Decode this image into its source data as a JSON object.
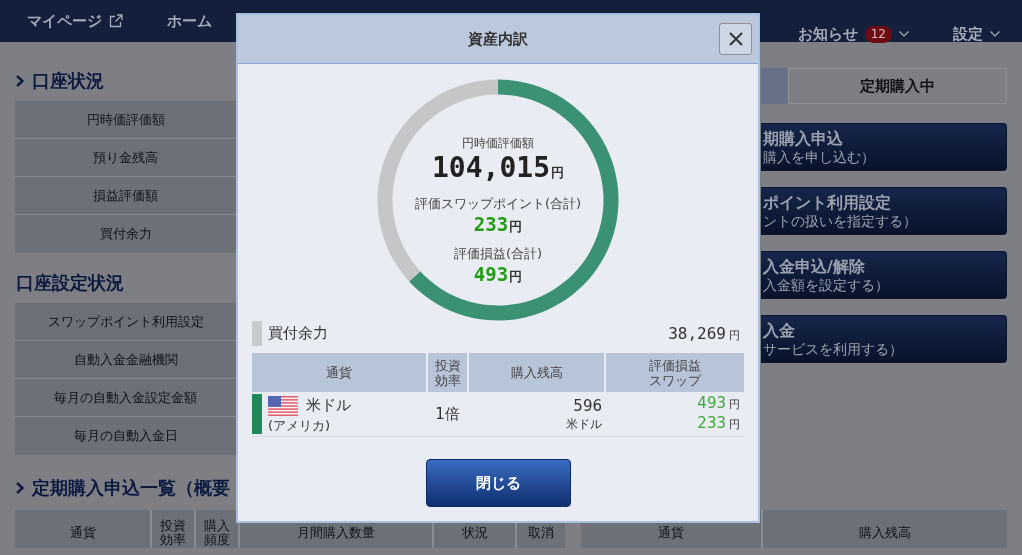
{
  "nav": {
    "left": [
      {
        "label": "マイページ",
        "external": true
      },
      {
        "label": "ホーム",
        "external": false
      }
    ],
    "right": [
      {
        "label": "お知らせ",
        "badge": "12",
        "dropdown": true
      },
      {
        "label": "設定",
        "dropdown": true
      }
    ]
  },
  "sections": [
    {
      "title": "口座状況",
      "chevron": true,
      "rows": [
        "円時価評価額",
        "預り金残高",
        "損益評価額",
        "買付余力"
      ]
    },
    {
      "title": "口座設定状況",
      "chevron": false,
      "rows": [
        "スワップポイント利用設定",
        "自動入金金融機関",
        "毎月の自動入金設定金額",
        "毎月の自動入金日"
      ]
    }
  ],
  "plan_list": {
    "title": "定期購入申込一覧（概要",
    "chevron": true,
    "columns": [
      "通貨",
      "投資効率",
      "購入頻度",
      "月間購入数量",
      "状況",
      "取消"
    ]
  },
  "right_panel": {
    "tabs": [
      {
        "selected": true
      },
      {
        "label": "定期購入中",
        "selected": false
      }
    ],
    "actions": [
      {
        "title": "期購入申込",
        "subtitle": "購入を申し込む）"
      },
      {
        "title": "ポイント利用設定",
        "subtitle": "ントの扱いを指定する）"
      },
      {
        "title": "入金申込/解除",
        "subtitle": "入金額を設定する）"
      },
      {
        "title": "入金",
        "subtitle": "サービスを利用する）"
      }
    ],
    "table_columns": [
      "通貨",
      "購入残高"
    ]
  },
  "modal": {
    "title": "資産内訳",
    "chart_data": {
      "type": "donut",
      "values": [
        63.2,
        36.8
      ],
      "colors": [
        "#3b9174",
        "#c4c6c7"
      ]
    },
    "total": {
      "label": "円時価評価額",
      "value": "104,015",
      "unit": "円"
    },
    "swap": {
      "label": "評価スワップポイント(合計)",
      "value": "233",
      "unit": "円"
    },
    "pl": {
      "label": "評価損益(合計)",
      "value": "493",
      "unit": "円"
    },
    "buying_power": {
      "label": "買付余力",
      "value": "38,269",
      "unit": "円",
      "color": "#c8c9ca"
    },
    "holdings": {
      "columns": [
        "通貨",
        "投資効率",
        "購入残高",
        "評価損益スワップ"
      ],
      "rows": [
        {
          "currency": "米ドル",
          "country": "(アメリカ)",
          "leverage": "1倍",
          "balance": "596",
          "balance_unit": "米ドル",
          "pl": "493",
          "pl_unit": "円",
          "swap": "233",
          "swap_unit": "円",
          "color": "#22885a"
        }
      ]
    },
    "close_button": "閉じる"
  }
}
